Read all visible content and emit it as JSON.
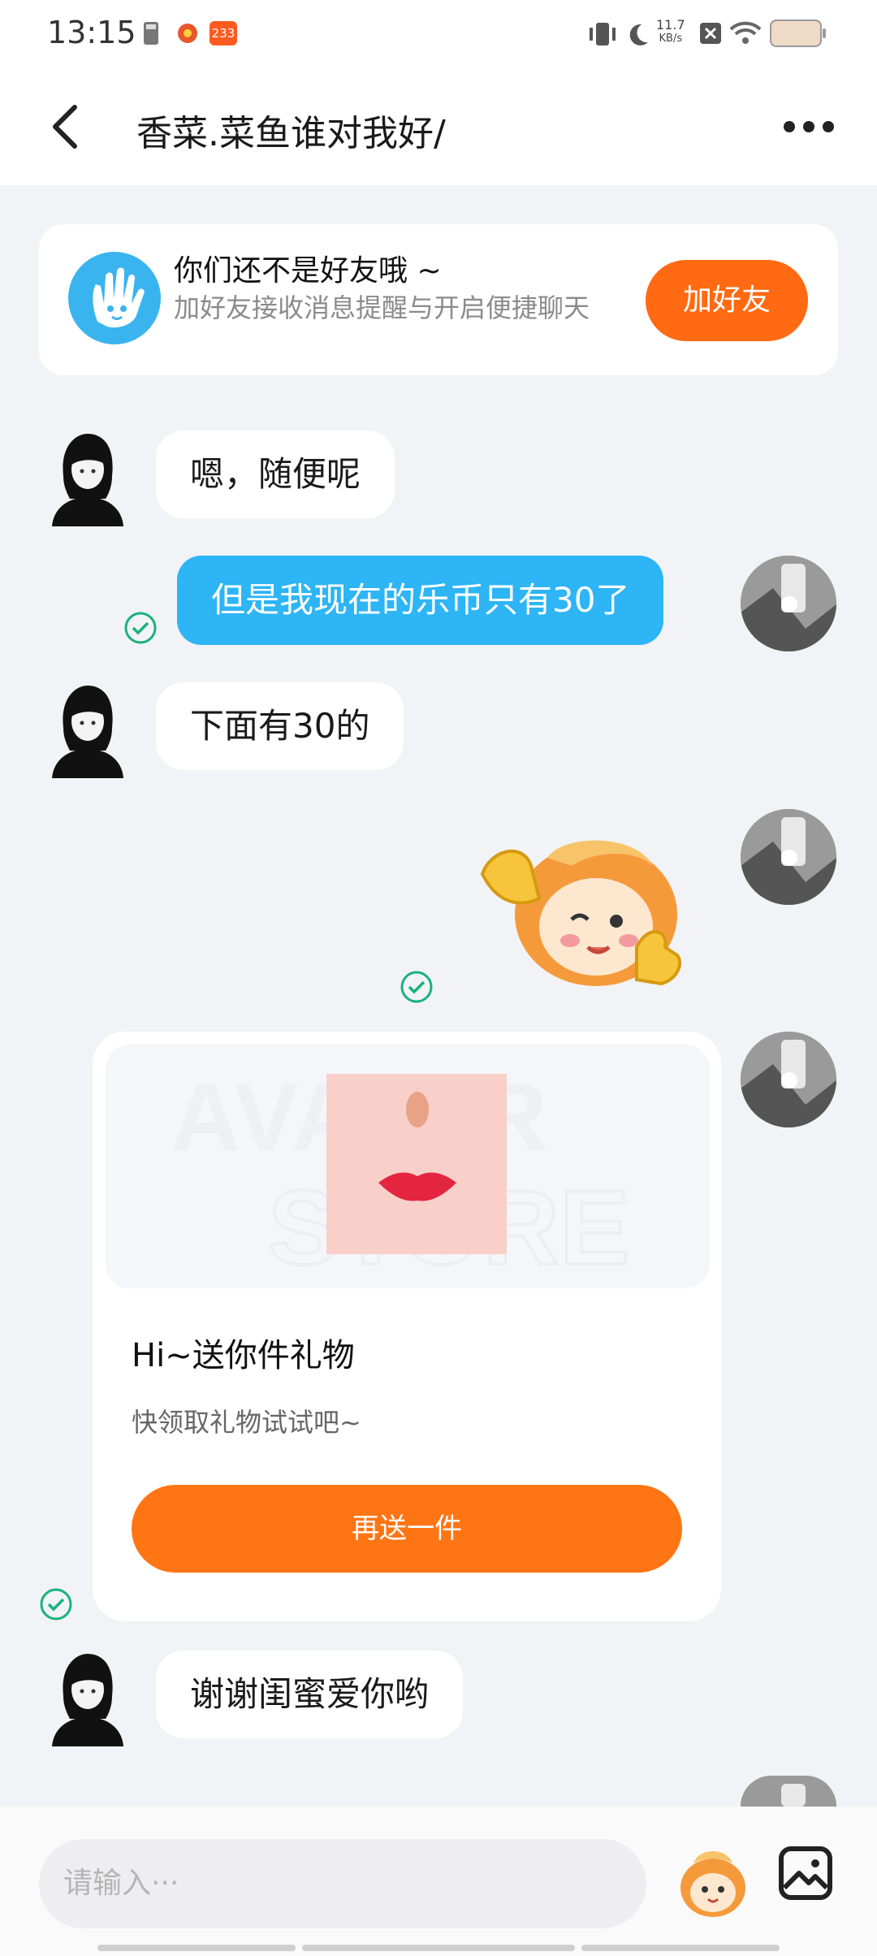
{
  "status_bar": {
    "time": "13:15",
    "notification_badge": "233",
    "network_speed": "11.7",
    "network_unit": "KB/s"
  },
  "header": {
    "title": "香菜.菜鱼谁对我好/"
  },
  "friend_banner": {
    "title": "你们还不是好友哦 ~",
    "subtitle": "加好友接收消息提醒与开启便捷聊天",
    "button": "加好友"
  },
  "messages": [
    {
      "side": "left",
      "text": "嗯，随便呢"
    },
    {
      "side": "right",
      "text": "但是我现在的乐币只有30了",
      "read": true
    },
    {
      "side": "left",
      "text": "下面有30的"
    },
    {
      "side": "right",
      "type": "sticker",
      "read": true
    },
    {
      "side": "right",
      "type": "gift",
      "read": true
    },
    {
      "side": "left",
      "text": "谢谢闺蜜爱你哟"
    }
  ],
  "gift_card": {
    "title": "Hi~送你件礼物",
    "subtitle": "快领取礼物试试吧~",
    "button": "再送一件"
  },
  "input_bar": {
    "placeholder": "请输入···"
  },
  "colors": {
    "accent_orange": "#ff6a13",
    "sent_bubble": "#2db5f5",
    "read_check": "#19b27a",
    "page_bg": "#f2f3f7"
  }
}
